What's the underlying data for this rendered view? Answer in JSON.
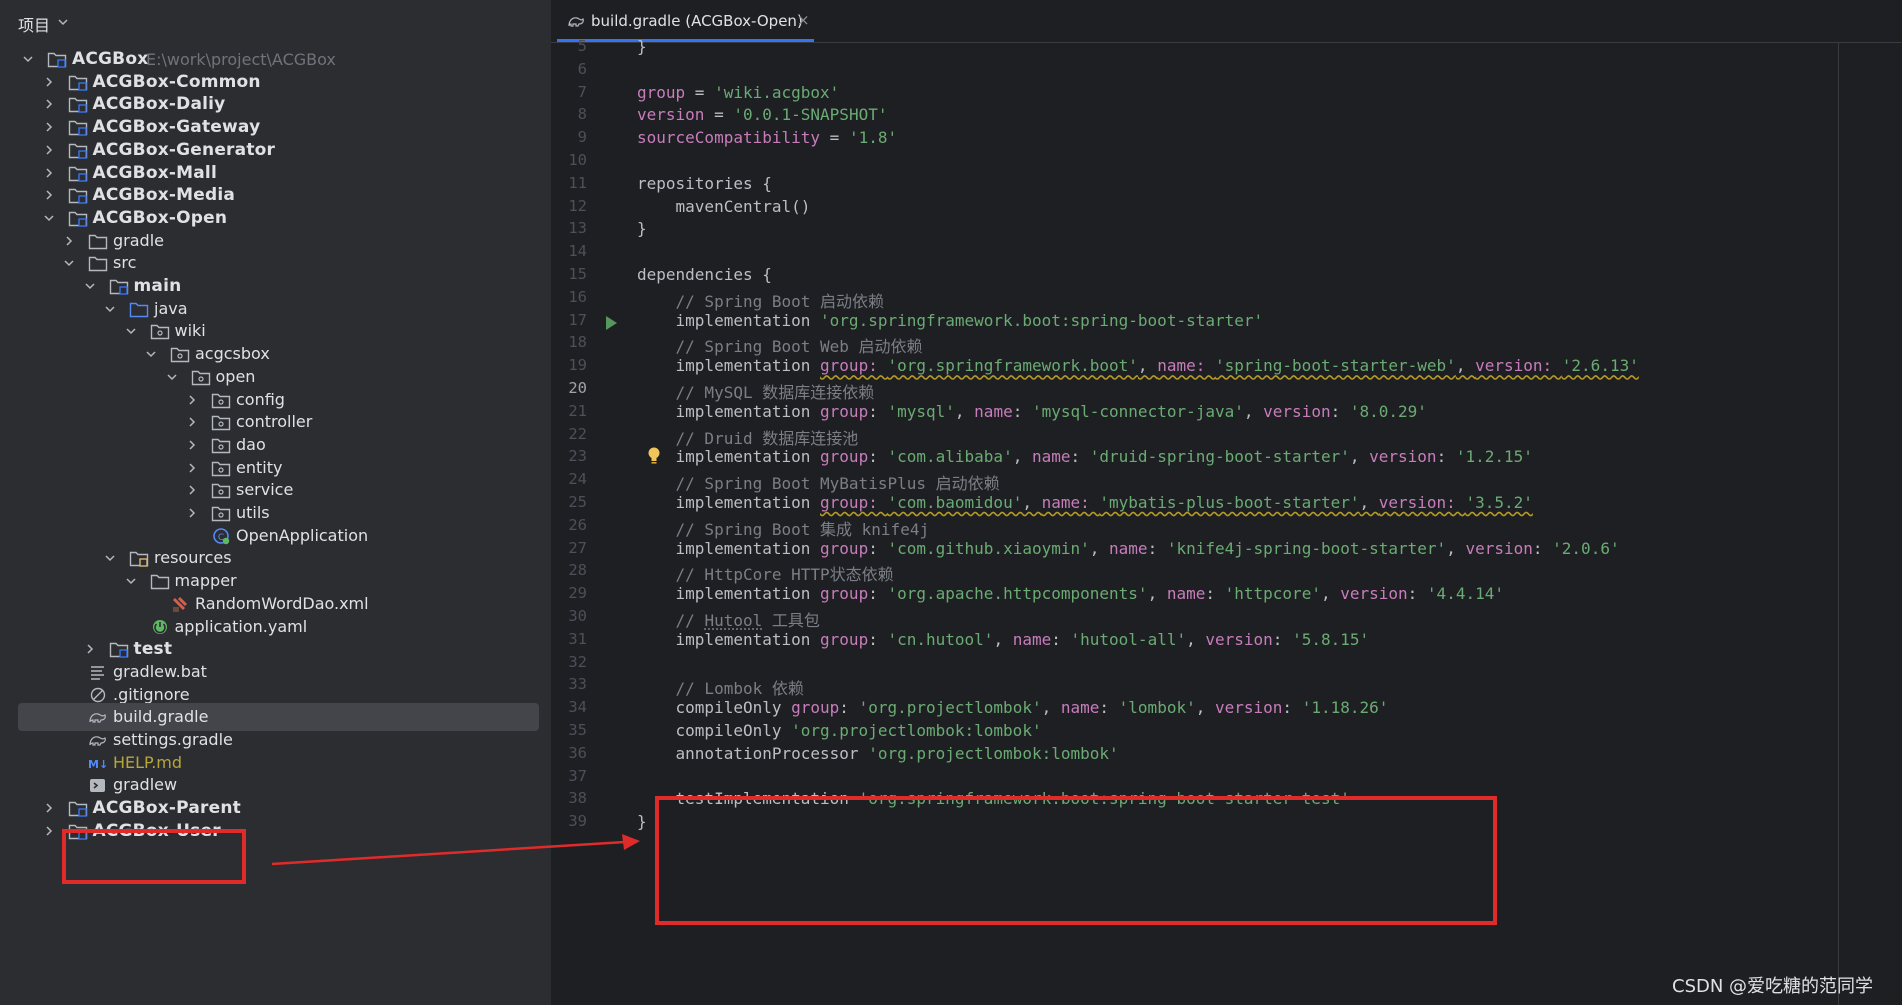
{
  "panel": {
    "title": "项目"
  },
  "tree": [
    {
      "label": "ACGBox",
      "path": "E:\\work\\project\\ACGBox",
      "depth": 0,
      "arrow": "down",
      "icon": "module-folder",
      "module": true
    },
    {
      "label": "ACGBox-Common",
      "depth": 1,
      "arrow": "right",
      "icon": "module-folder",
      "module": true
    },
    {
      "label": "ACGBox-Daliy",
      "depth": 1,
      "arrow": "right",
      "icon": "module-folder",
      "module": true
    },
    {
      "label": "ACGBox-Gateway",
      "depth": 1,
      "arrow": "right",
      "icon": "module-folder",
      "module": true
    },
    {
      "label": "ACGBox-Generator",
      "depth": 1,
      "arrow": "right",
      "icon": "module-folder",
      "module": true
    },
    {
      "label": "ACGBox-Mall",
      "depth": 1,
      "arrow": "right",
      "icon": "module-folder",
      "module": true
    },
    {
      "label": "ACGBox-Media",
      "depth": 1,
      "arrow": "right",
      "icon": "module-folder",
      "module": true
    },
    {
      "label": "ACGBox-Open",
      "depth": 1,
      "arrow": "down",
      "icon": "module-folder",
      "module": true
    },
    {
      "label": "gradle",
      "depth": 2,
      "arrow": "right",
      "icon": "folder"
    },
    {
      "label": "src",
      "depth": 2,
      "arrow": "down",
      "icon": "folder"
    },
    {
      "label": "main",
      "depth": 3,
      "arrow": "down",
      "icon": "module-folder",
      "module": true
    },
    {
      "label": "java",
      "depth": 4,
      "arrow": "down",
      "icon": "source-folder"
    },
    {
      "label": "wiki",
      "depth": 5,
      "arrow": "down",
      "icon": "package-folder"
    },
    {
      "label": "acgcsbox",
      "depth": 6,
      "arrow": "down",
      "icon": "package-folder"
    },
    {
      "label": "open",
      "depth": 7,
      "arrow": "down",
      "icon": "package-folder"
    },
    {
      "label": "config",
      "depth": 8,
      "arrow": "right",
      "icon": "package-folder"
    },
    {
      "label": "controller",
      "depth": 8,
      "arrow": "right",
      "icon": "package-folder"
    },
    {
      "label": "dao",
      "depth": 8,
      "arrow": "right",
      "icon": "package-folder"
    },
    {
      "label": "entity",
      "depth": 8,
      "arrow": "right",
      "icon": "package-folder"
    },
    {
      "label": "service",
      "depth": 8,
      "arrow": "right",
      "icon": "package-folder"
    },
    {
      "label": "utils",
      "depth": 8,
      "arrow": "right",
      "icon": "package-folder"
    },
    {
      "label": "OpenApplication",
      "depth": 8,
      "arrow": "none",
      "icon": "spring-class"
    },
    {
      "label": "resources",
      "depth": 4,
      "arrow": "down",
      "icon": "resources-folder"
    },
    {
      "label": "mapper",
      "depth": 5,
      "arrow": "down",
      "icon": "folder"
    },
    {
      "label": "RandomWordDao.xml",
      "depth": 6,
      "arrow": "none",
      "icon": "xml-file"
    },
    {
      "label": "application.yaml",
      "depth": 5,
      "arrow": "none",
      "icon": "spring-config"
    },
    {
      "label": "test",
      "depth": 3,
      "arrow": "right",
      "icon": "module-folder",
      "module": true
    },
    {
      "label": "gradlew.bat",
      "depth": 2,
      "arrow": "none",
      "icon": "text-file"
    },
    {
      "label": ".gitignore",
      "depth": 2,
      "arrow": "none",
      "icon": "ignore-file"
    },
    {
      "label": "build.gradle",
      "depth": 2,
      "arrow": "none",
      "icon": "gradle-file",
      "selected": true
    },
    {
      "label": "settings.gradle",
      "depth": 2,
      "arrow": "none",
      "icon": "gradle-file"
    },
    {
      "label": "HELP.md",
      "depth": 2,
      "arrow": "none",
      "icon": "markdown-file",
      "yellow": true
    },
    {
      "label": "gradlew",
      "depth": 2,
      "arrow": "none",
      "icon": "terminal-file"
    },
    {
      "label": "ACGBox-Parent",
      "depth": 1,
      "arrow": "right",
      "icon": "module-folder",
      "module": true
    },
    {
      "label": "ACGBox-User",
      "depth": 1,
      "arrow": "right",
      "icon": "module-folder",
      "module": true
    }
  ],
  "tab": {
    "label": "build.gradle (ACGBox-Open)",
    "close": "×"
  },
  "active_line": 20,
  "code": [
    {
      "n": 5,
      "t": [
        [
          "p",
          "}"
        ]
      ]
    },
    {
      "n": 6,
      "t": []
    },
    {
      "n": 7,
      "t": [
        [
          "k",
          "group"
        ],
        [
          "p",
          " = "
        ],
        [
          "s",
          "'wiki.acgbox'"
        ]
      ]
    },
    {
      "n": 8,
      "t": [
        [
          "k",
          "version"
        ],
        [
          "p",
          " = "
        ],
        [
          "s",
          "'0.0.1-SNAPSHOT'"
        ]
      ]
    },
    {
      "n": 9,
      "t": [
        [
          "k",
          "sourceCompatibility"
        ],
        [
          "p",
          " = "
        ],
        [
          "s",
          "'1.8'"
        ]
      ]
    },
    {
      "n": 10,
      "t": []
    },
    {
      "n": 11,
      "t": [
        [
          "p",
          "repositories {"
        ]
      ]
    },
    {
      "n": 12,
      "t": [
        [
          "p",
          "    mavenCentral()"
        ]
      ]
    },
    {
      "n": 13,
      "t": [
        [
          "p",
          "}"
        ]
      ]
    },
    {
      "n": 14,
      "t": []
    },
    {
      "n": 15,
      "t": [
        [
          "p",
          "dependencies {"
        ]
      ]
    },
    {
      "n": 16,
      "t": [
        [
          "c",
          "    // Spring Boot 启动依赖"
        ]
      ]
    },
    {
      "n": 17,
      "t": [
        [
          "p",
          "    implementation "
        ],
        [
          "s",
          "'org.springframework.boot:spring-boot-starter'"
        ]
      ]
    },
    {
      "n": 18,
      "t": [
        [
          "c",
          "    // Spring Boot Web 启动依赖"
        ]
      ]
    },
    {
      "n": 19,
      "t": [
        [
          "p",
          "    implementation "
        ],
        [
          "kw",
          "group: "
        ],
        [
          "sw",
          "'org.springframework.boot'"
        ],
        [
          "pw",
          ", "
        ],
        [
          "kw",
          "name: "
        ],
        [
          "sw",
          "'spring-boot-starter-web'"
        ],
        [
          "pw",
          ", "
        ],
        [
          "kw",
          "version: "
        ],
        [
          "sw",
          "'2.6.13'"
        ]
      ]
    },
    {
      "n": 20,
      "t": [
        [
          "c",
          "    // MySQL 数据库连接依赖"
        ]
      ]
    },
    {
      "n": 21,
      "t": [
        [
          "p",
          "    implementation "
        ],
        [
          "k",
          "group"
        ],
        [
          "p",
          ": "
        ],
        [
          "s",
          "'mysql'"
        ],
        [
          "p",
          ", "
        ],
        [
          "k",
          "name"
        ],
        [
          "p",
          ": "
        ],
        [
          "s",
          "'mysql-connector-java'"
        ],
        [
          "p",
          ", "
        ],
        [
          "k",
          "version"
        ],
        [
          "p",
          ": "
        ],
        [
          "s",
          "'8.0.29'"
        ]
      ]
    },
    {
      "n": 22,
      "t": [
        [
          "c",
          "    // Druid 数据库连接池"
        ]
      ]
    },
    {
      "n": 23,
      "t": [
        [
          "p",
          "    implementation "
        ],
        [
          "k",
          "group"
        ],
        [
          "p",
          ": "
        ],
        [
          "s",
          "'com.alibaba'"
        ],
        [
          "p",
          ", "
        ],
        [
          "k",
          "name"
        ],
        [
          "p",
          ": "
        ],
        [
          "s",
          "'druid-spring-boot-starter'"
        ],
        [
          "p",
          ", "
        ],
        [
          "k",
          "version"
        ],
        [
          "p",
          ": "
        ],
        [
          "s",
          "'1.2.15'"
        ]
      ]
    },
    {
      "n": 24,
      "t": [
        [
          "c",
          "    // Spring Boot MyBatisPlus 启动依赖"
        ]
      ]
    },
    {
      "n": 25,
      "t": [
        [
          "p",
          "    implementation "
        ],
        [
          "kw",
          "group: "
        ],
        [
          "sw",
          "'com.baomidou'"
        ],
        [
          "pw",
          ", "
        ],
        [
          "kw",
          "name: "
        ],
        [
          "sw",
          "'mybatis-plus-boot-starter'"
        ],
        [
          "pw",
          ", "
        ],
        [
          "kw",
          "version: "
        ],
        [
          "sw",
          "'3.5.2'"
        ]
      ]
    },
    {
      "n": 26,
      "t": [
        [
          "c",
          "    // Spring Boot 集成 knife4j"
        ]
      ]
    },
    {
      "n": 27,
      "t": [
        [
          "p",
          "    implementation "
        ],
        [
          "k",
          "group"
        ],
        [
          "p",
          ": "
        ],
        [
          "s",
          "'com.github.xiaoymin'"
        ],
        [
          "p",
          ", "
        ],
        [
          "k",
          "name"
        ],
        [
          "p",
          ": "
        ],
        [
          "s",
          "'knife4j-spring-boot-starter'"
        ],
        [
          "p",
          ", "
        ],
        [
          "k",
          "version"
        ],
        [
          "p",
          ": "
        ],
        [
          "s",
          "'2.0.6'"
        ]
      ]
    },
    {
      "n": 28,
      "t": [
        [
          "c",
          "    // HttpCore HTTP状态依赖"
        ]
      ]
    },
    {
      "n": 29,
      "t": [
        [
          "p",
          "    implementation "
        ],
        [
          "k",
          "group"
        ],
        [
          "p",
          ": "
        ],
        [
          "s",
          "'org.apache.httpcomponents'"
        ],
        [
          "p",
          ", "
        ],
        [
          "k",
          "name"
        ],
        [
          "p",
          ": "
        ],
        [
          "s",
          "'httpcore'"
        ],
        [
          "p",
          ", "
        ],
        [
          "k",
          "version"
        ],
        [
          "p",
          ": "
        ],
        [
          "s",
          "'4.4.14'"
        ]
      ]
    },
    {
      "n": 30,
      "t": [
        [
          "c",
          "    // "
        ],
        [
          "ct",
          "Hutool"
        ],
        [
          "c",
          " 工具包"
        ]
      ]
    },
    {
      "n": 31,
      "t": [
        [
          "p",
          "    implementation "
        ],
        [
          "k",
          "group"
        ],
        [
          "p",
          ": "
        ],
        [
          "s",
          "'cn.hutool'"
        ],
        [
          "p",
          ", "
        ],
        [
          "k",
          "name"
        ],
        [
          "p",
          ": "
        ],
        [
          "s",
          "'hutool-all'"
        ],
        [
          "p",
          ", "
        ],
        [
          "k",
          "version"
        ],
        [
          "p",
          ": "
        ],
        [
          "s",
          "'5.8.15'"
        ]
      ]
    },
    {
      "n": 32,
      "t": []
    },
    {
      "n": 33,
      "t": [
        [
          "c",
          "    // Lombok 依赖"
        ]
      ]
    },
    {
      "n": 34,
      "t": [
        [
          "p",
          "    compileOnly "
        ],
        [
          "k",
          "group"
        ],
        [
          "p",
          ": "
        ],
        [
          "s",
          "'org.projectlombok'"
        ],
        [
          "p",
          ", "
        ],
        [
          "k",
          "name"
        ],
        [
          "p",
          ": "
        ],
        [
          "s",
          "'lombok'"
        ],
        [
          "p",
          ", "
        ],
        [
          "k",
          "version"
        ],
        [
          "p",
          ": "
        ],
        [
          "s",
          "'1.18.26'"
        ]
      ]
    },
    {
      "n": 35,
      "t": [
        [
          "p",
          "    compileOnly "
        ],
        [
          "s",
          "'org.projectlombok:lombok'"
        ]
      ]
    },
    {
      "n": 36,
      "t": [
        [
          "p",
          "    annotationProcessor "
        ],
        [
          "s",
          "'org.projectlombok:lombok'"
        ]
      ]
    },
    {
      "n": 37,
      "t": []
    },
    {
      "n": 38,
      "t": [
        [
          "p",
          "    testImplementation "
        ],
        [
          "s",
          "'org.springframework.boot:spring-boot-starter-test'"
        ]
      ]
    },
    {
      "n": 39,
      "t": [
        [
          "p",
          "}"
        ]
      ]
    }
  ],
  "watermark": "CSDN @爱吃糖的范同学",
  "colors": {
    "annotation": "#e02b2b",
    "keyword": "#c77dbb",
    "string": "#6aab73",
    "comment": "#7a7e85"
  }
}
